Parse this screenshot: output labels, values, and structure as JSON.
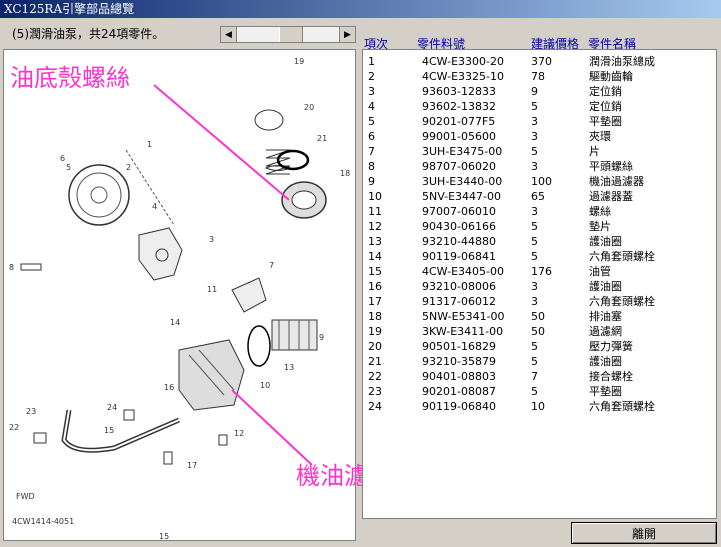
{
  "window": {
    "title": "XC125RA引擎部品總覽"
  },
  "subtitle": "(5)潤滑油泵，共24項零件。",
  "annotations": {
    "top": "油底殼螺絲",
    "bottom": "機油濾芯外蓋"
  },
  "diagram": {
    "code": "4CW1414-4051",
    "page": "15",
    "fwd": "FWD",
    "labels": [
      "1",
      "2",
      "3",
      "4",
      "5",
      "6",
      "7",
      "8",
      "9",
      "10",
      "11",
      "12",
      "13",
      "14",
      "15",
      "16",
      "17",
      "18",
      "19",
      "20",
      "21",
      "22",
      "23",
      "24"
    ]
  },
  "columns": {
    "idx": "項次",
    "part_no": "零件料號",
    "price": "建議價格",
    "name": "零件名稱"
  },
  "rows": [
    [
      "1",
      "4CW-E3300-20",
      "370",
      "潤滑油泵總成"
    ],
    [
      "2",
      "4CW-E3325-10",
      "78",
      "驅動齒輪"
    ],
    [
      "3",
      "93603-12833",
      "9",
      "定位銷"
    ],
    [
      "4",
      "93602-13832",
      "5",
      "定位銷"
    ],
    [
      "5",
      "90201-077F5",
      "3",
      "平墊圈"
    ],
    [
      "6",
      "99001-05600",
      "3",
      "夾環"
    ],
    [
      "7",
      "3UH-E3475-00",
      "5",
      "片"
    ],
    [
      "8",
      "98707-06020",
      "3",
      "平頭螺絲"
    ],
    [
      "9",
      "3UH-E3440-00",
      "100",
      "機油過濾器"
    ],
    [
      "10",
      "5NV-E3447-00",
      "65",
      "過濾器蓋"
    ],
    [
      "11",
      "97007-06010",
      "3",
      "螺絲"
    ],
    [
      "12",
      "90430-06166",
      "5",
      "墊片"
    ],
    [
      "13",
      "93210-44880",
      "5",
      "護油圈"
    ],
    [
      "14",
      "90119-06841",
      "5",
      "六角套頭螺栓"
    ],
    [
      "15",
      "4CW-E3405-00",
      "176",
      "油管"
    ],
    [
      "16",
      "93210-08006",
      "3",
      "護油圈"
    ],
    [
      "17",
      "91317-06012",
      "3",
      "六角套頭螺栓"
    ],
    [
      "18",
      "5NW-E5341-00",
      "50",
      "排油塞"
    ],
    [
      "19",
      "3KW-E3411-00",
      "50",
      "過濾網"
    ],
    [
      "20",
      "90501-16829",
      "5",
      "壓力彈簧"
    ],
    [
      "21",
      "93210-35879",
      "5",
      "護油圈"
    ],
    [
      "22",
      "90401-08803",
      "7",
      "接合螺栓"
    ],
    [
      "23",
      "90201-08087",
      "5",
      "平墊圈"
    ],
    [
      "24",
      "90119-06840",
      "10",
      "六角套頭螺栓"
    ]
  ],
  "buttons": {
    "close": "離開"
  },
  "icons": {
    "scroll_left": "arrow-left-icon",
    "scroll_right": "arrow-right-icon"
  },
  "colors": {
    "annotation": "#ff33cc",
    "header_text": "#0000aa",
    "title_start": "#0a246a"
  }
}
